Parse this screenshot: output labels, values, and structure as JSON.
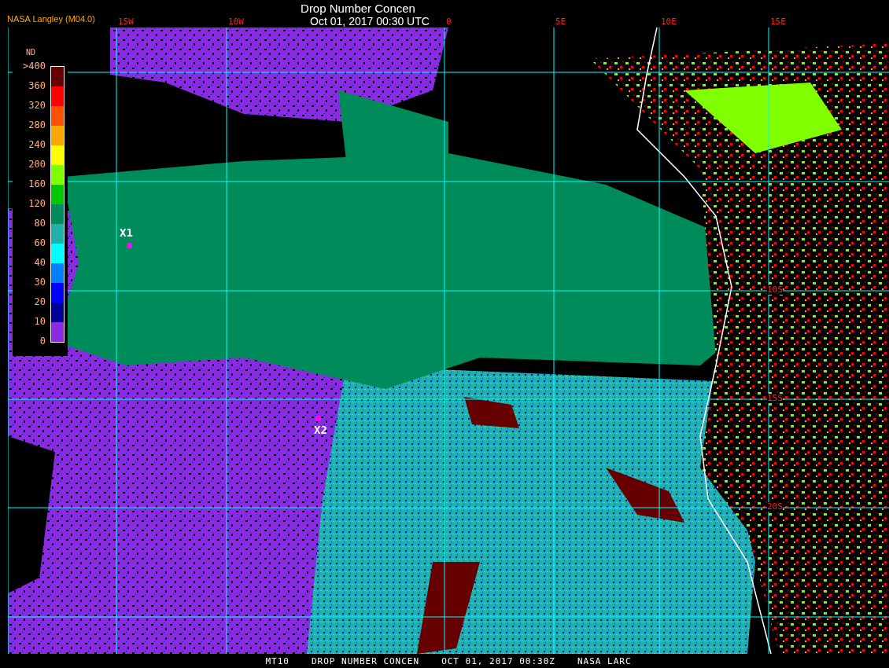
{
  "header": {
    "source": "NASA Langley (M04.0)",
    "title": "Drop Number Concen",
    "timestamp": "Oct 01, 2017 00:30 UTC"
  },
  "map": {
    "longitude_labels": [
      "15W",
      "10W",
      "0",
      "5E",
      "10E",
      "15E"
    ],
    "latitude_labels": [
      "10S",
      "15S",
      "20S"
    ],
    "markers": [
      {
        "label": "X1"
      },
      {
        "label": "X2"
      }
    ]
  },
  "legend": {
    "title": "ND",
    "labels": [
      ">400",
      "360",
      "320",
      "280",
      "240",
      "200",
      "160",
      "120",
      "80",
      "60",
      "40",
      "30",
      "20",
      "10",
      "0"
    ],
    "swatches": [
      {
        "color": "#660000"
      },
      {
        "color": "#ff0000"
      },
      {
        "color": "#ff5000"
      },
      {
        "color": "#ffa500"
      },
      {
        "color": "#ffff00"
      },
      {
        "color": "#80ff00"
      },
      {
        "color": "#00c800"
      },
      {
        "color": "#008b5a"
      },
      {
        "color": "#20b2aa"
      },
      {
        "color": "#00ffff"
      },
      {
        "color": "#0080ff"
      },
      {
        "color": "#0000ff"
      },
      {
        "color": "#000099"
      },
      {
        "color": "#8a2be2"
      }
    ]
  },
  "footer": [
    "MT10",
    "DROP NUMBER CONCEN",
    "OCT 01, 2017 00:30Z",
    "NASA LARC"
  ]
}
